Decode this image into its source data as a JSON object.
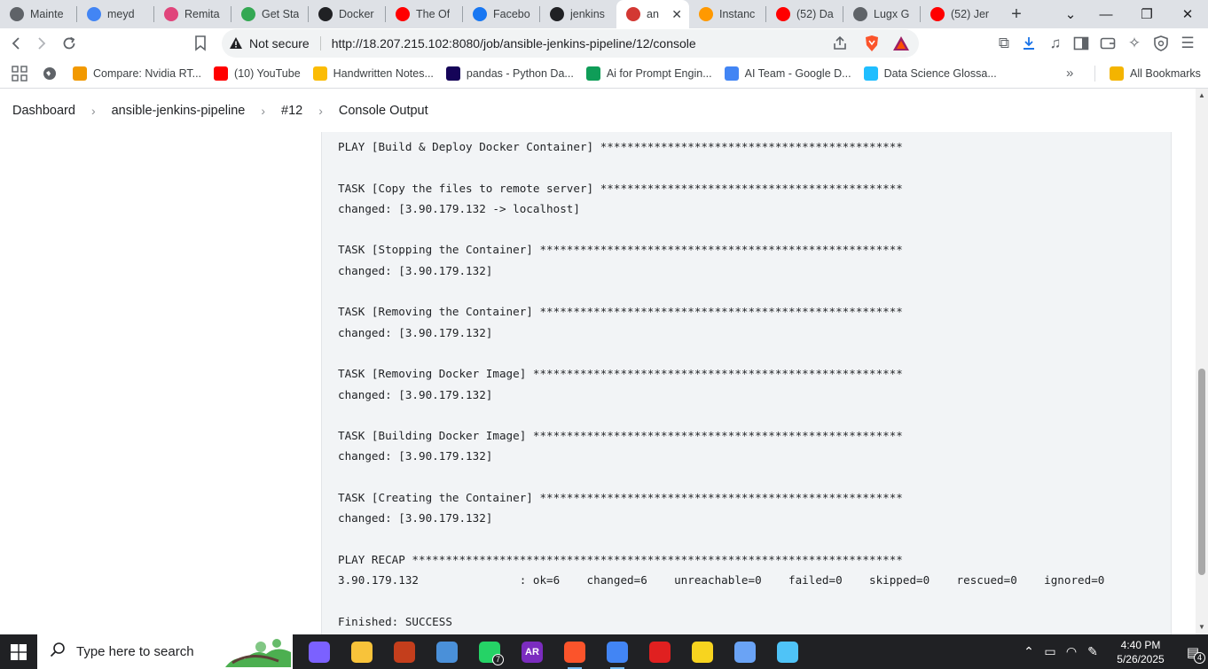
{
  "browser": {
    "tabs": [
      {
        "title": "Mainte",
        "icon": "globe-icon",
        "color": "#5f6368"
      },
      {
        "title": "meyd",
        "icon": "google-icon",
        "color": "#4285f4"
      },
      {
        "title": "Remita",
        "icon": "remita-icon",
        "color": "#e0457b"
      },
      {
        "title": "Get Sta",
        "icon": "getstarted-icon",
        "color": "#34a853"
      },
      {
        "title": "Docker",
        "icon": "openai-icon",
        "color": "#202124"
      },
      {
        "title": "The Of",
        "icon": "youtube-icon",
        "color": "#ff0000"
      },
      {
        "title": "Facebo",
        "icon": "facebook-icon",
        "color": "#1877f2"
      },
      {
        "title": "jenkins",
        "icon": "github-icon",
        "color": "#202124"
      },
      {
        "title": "an",
        "icon": "jenkins-icon",
        "color": "#d33833",
        "active": true
      },
      {
        "title": "Instanc",
        "icon": "aws-icon",
        "color": "#ff9900"
      },
      {
        "title": "(52) Da",
        "icon": "youtube-icon",
        "color": "#ff0000"
      },
      {
        "title": "Lugx G",
        "icon": "globe-icon",
        "color": "#5f6368"
      },
      {
        "title": "(52) Jer",
        "icon": "youtube-icon",
        "color": "#ff0000"
      }
    ],
    "address": {
      "security_label": "Not secure",
      "url": "http://18.207.215.102:8080/job/ansible-jenkins-pipeline/12/console"
    },
    "bookmarks": [
      {
        "label": "Compare: Nvidia RT...",
        "icon": "speedometer-icon",
        "color": "#f29900"
      },
      {
        "label": "(10) YouTube",
        "icon": "youtube-icon",
        "color": "#ff0000"
      },
      {
        "label": "Handwritten Notes...",
        "icon": "drive-icon",
        "color": "#fbbc04"
      },
      {
        "label": "pandas - Python Da...",
        "icon": "pandas-icon",
        "color": "#150458"
      },
      {
        "label": "Ai for Prompt Engin...",
        "icon": "sheets-icon",
        "color": "#0f9d58"
      },
      {
        "label": "AI Team - Google D...",
        "icon": "drive-icon",
        "color": "#4285f4"
      },
      {
        "label": "Data Science Glossa...",
        "icon": "kaggle-icon",
        "color": "#20beff"
      }
    ],
    "all_bookmarks": "All Bookmarks"
  },
  "jenkins": {
    "breadcrumb": [
      "Dashboard",
      "ansible-jenkins-pipeline",
      "#12",
      "Console Output"
    ],
    "console_lines": [
      "PLAY [Build & Deploy Docker Container] *********************************************",
      "",
      "TASK [Copy the files to remote server] *********************************************",
      "changed: [3.90.179.132 -> localhost]",
      "",
      "TASK [Stopping the Container] ******************************************************",
      "changed: [3.90.179.132]",
      "",
      "TASK [Removing the Container] ******************************************************",
      "changed: [3.90.179.132]",
      "",
      "TASK [Removing Docker Image] *******************************************************",
      "changed: [3.90.179.132]",
      "",
      "TASK [Building Docker Image] *******************************************************",
      "changed: [3.90.179.132]",
      "",
      "TASK [Creating the Container] ******************************************************",
      "changed: [3.90.179.132]",
      "",
      "PLAY RECAP *************************************************************************",
      "3.90.179.132               : ok=6    changed=6    unreachable=0    failed=0    skipped=0    rescued=0    ignored=0",
      "",
      "Finished: SUCCESS"
    ]
  },
  "taskbar": {
    "search_placeholder": "Type here to search",
    "apps": [
      {
        "name": "copilot-icon",
        "color": "#7b61ff"
      },
      {
        "name": "file-explorer-icon",
        "color": "#f8c33a"
      },
      {
        "name": "m365-icon",
        "color": "#c43e1c"
      },
      {
        "name": "notepad-icon",
        "color": "#4a90d9"
      },
      {
        "name": "whatsapp-icon",
        "color": "#25d366",
        "badge": "7"
      },
      {
        "name": "ar-app-icon",
        "color": "#7b2cbf",
        "label": "AR"
      },
      {
        "name": "brave-icon",
        "color": "#fb542b",
        "running": true
      },
      {
        "name": "chrome-icon",
        "color": "#4285f4",
        "running": true
      },
      {
        "name": "wps-icon",
        "color": "#e02020"
      },
      {
        "name": "sticky-notes-icon",
        "color": "#f7d41f"
      },
      {
        "name": "gem-icon",
        "color": "#6aa3f5"
      },
      {
        "name": "paint-icon",
        "color": "#4fc3f7"
      }
    ],
    "time": "4:40 PM",
    "date": "5/26/2025",
    "notifications": "4"
  }
}
